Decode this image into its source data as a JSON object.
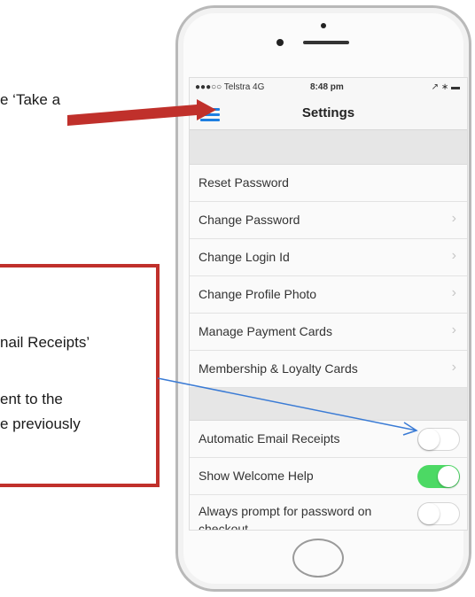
{
  "callouts": {
    "top_fragment": "e ‘Take a",
    "box_line1": "nail Receipts’",
    "box_line2": "ent to the",
    "box_line3": "e previously"
  },
  "status_bar": {
    "signal": "●●●○○ Telstra  4G",
    "time": "8:48 pm",
    "right_icons": "↗ ∗ ▬"
  },
  "nav": {
    "title": "Settings",
    "menu_icon": "hamburger-icon"
  },
  "menu_items": [
    {
      "label": "Reset Password",
      "chevron": ""
    },
    {
      "label": "Change Password",
      "chevron": "›"
    },
    {
      "label": "Change Login Id",
      "chevron": "›"
    },
    {
      "label": "Change Profile Photo",
      "chevron": "›"
    },
    {
      "label": "Manage Payment Cards",
      "chevron": "›"
    },
    {
      "label": "Membership & Loyalty Cards",
      "chevron": "›"
    }
  ],
  "toggles": [
    {
      "label": "Automatic Email Receipts",
      "state": "off"
    },
    {
      "label": "Show Welcome Help",
      "state": "on"
    },
    {
      "label": "Always prompt for password on checkout",
      "state": "off"
    }
  ],
  "colors": {
    "annotation_red": "#c0302b",
    "arrow_blue": "#3a7bd5",
    "toggle_on": "#4cd964",
    "nav_accent": "#1e7fe0"
  }
}
